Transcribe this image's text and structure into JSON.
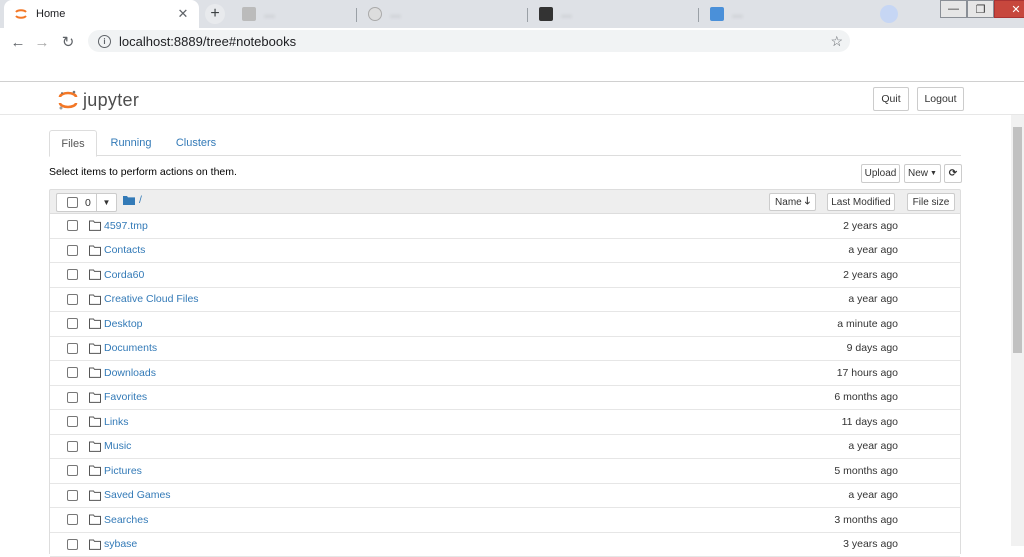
{
  "browser": {
    "tabs": [
      {
        "title": "Home",
        "active": true
      },
      {
        "title": "…",
        "active": false
      },
      {
        "title": "…",
        "active": false
      },
      {
        "title": "…",
        "active": false
      },
      {
        "title": "…",
        "active": false
      }
    ],
    "url": "localhost:8889/tree#notebooks"
  },
  "header": {
    "logo_text": "jupyter",
    "quit_label": "Quit",
    "logout_label": "Logout"
  },
  "tabs": [
    "Files",
    "Running",
    "Clusters"
  ],
  "toolbar": {
    "hint": "Select items to perform actions on them.",
    "upload_label": "Upload",
    "new_label": "New",
    "refresh_icon": "refresh-icon"
  },
  "list_header": {
    "selected_count": "0",
    "breadcrumb": "/",
    "sort_name_label": "Name",
    "last_modified_label": "Last Modified",
    "file_size_label": "File size"
  },
  "files": [
    {
      "name": "4597.tmp",
      "modified": "2 years ago"
    },
    {
      "name": "Contacts",
      "modified": "a year ago"
    },
    {
      "name": "Corda60",
      "modified": "2 years ago"
    },
    {
      "name": "Creative Cloud Files",
      "modified": "a year ago"
    },
    {
      "name": "Desktop",
      "modified": "a minute ago"
    },
    {
      "name": "Documents",
      "modified": "9 days ago"
    },
    {
      "name": "Downloads",
      "modified": "17 hours ago"
    },
    {
      "name": "Favorites",
      "modified": "6 months ago"
    },
    {
      "name": "Links",
      "modified": "11 days ago"
    },
    {
      "name": "Music",
      "modified": "a year ago"
    },
    {
      "name": "Pictures",
      "modified": "5 months ago"
    },
    {
      "name": "Saved Games",
      "modified": "a year ago"
    },
    {
      "name": "Searches",
      "modified": "3 months ago"
    },
    {
      "name": "sybase",
      "modified": "3 years ago"
    }
  ],
  "colors": {
    "link": "#337ab7",
    "jupyter_orange": "#f37726"
  }
}
